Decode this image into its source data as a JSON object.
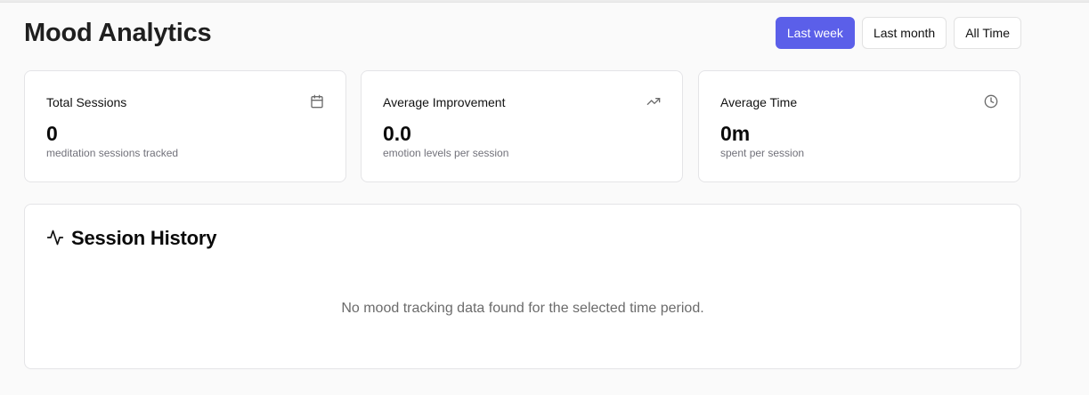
{
  "page": {
    "title": "Mood Analytics"
  },
  "range_filter": {
    "options": [
      "Last week",
      "Last month",
      "All Time"
    ],
    "selected": "Last week"
  },
  "stats": [
    {
      "label": "Total Sessions",
      "value": "0",
      "sub": "meditation sessions tracked",
      "icon": "calendar-icon"
    },
    {
      "label": "Average Improvement",
      "value": "0.0",
      "sub": "emotion levels per session",
      "icon": "trending-up-icon"
    },
    {
      "label": "Average Time",
      "value": "0m",
      "sub": "spent per session",
      "icon": "clock-icon"
    }
  ],
  "history": {
    "title": "Session History",
    "icon": "activity-icon",
    "empty_message": "No mood tracking data found for the selected time period."
  },
  "colors": {
    "accent": "#5b5fe9",
    "background": "#fafafa",
    "card": "#ffffff",
    "muted_text": "#71717a"
  }
}
